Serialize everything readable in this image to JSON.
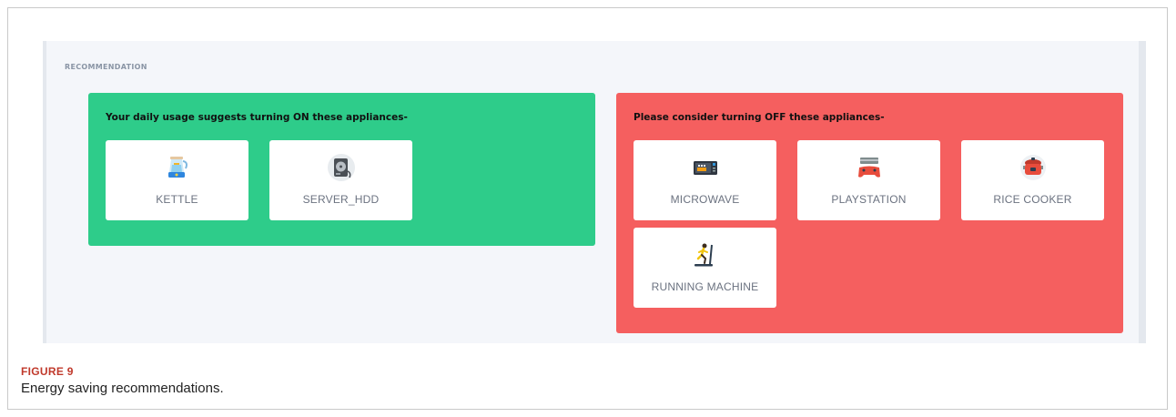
{
  "section_label": "RECOMMENDATION",
  "on_panel": {
    "title": "Your daily usage suggests turning ON these appliances-",
    "color": "#2ecc8a",
    "appliances": [
      {
        "label": "KETTLE",
        "icon": "kettle-icon"
      },
      {
        "label": "SERVER_HDD",
        "icon": "hard-drive-icon"
      }
    ]
  },
  "off_panel": {
    "title": "Please consider turning OFF these appliances-",
    "color": "#f55f5f",
    "appliances": [
      {
        "label": "MICROWAVE",
        "icon": "microwave-icon"
      },
      {
        "label": "PLAYSTATION",
        "icon": "game-console-icon"
      },
      {
        "label": "RICE COOKER",
        "icon": "rice-cooker-icon"
      },
      {
        "label": "RUNNING MACHINE",
        "icon": "treadmill-icon"
      }
    ]
  },
  "caption": {
    "figure": "FIGURE 9",
    "text": "Energy saving recommendations."
  }
}
